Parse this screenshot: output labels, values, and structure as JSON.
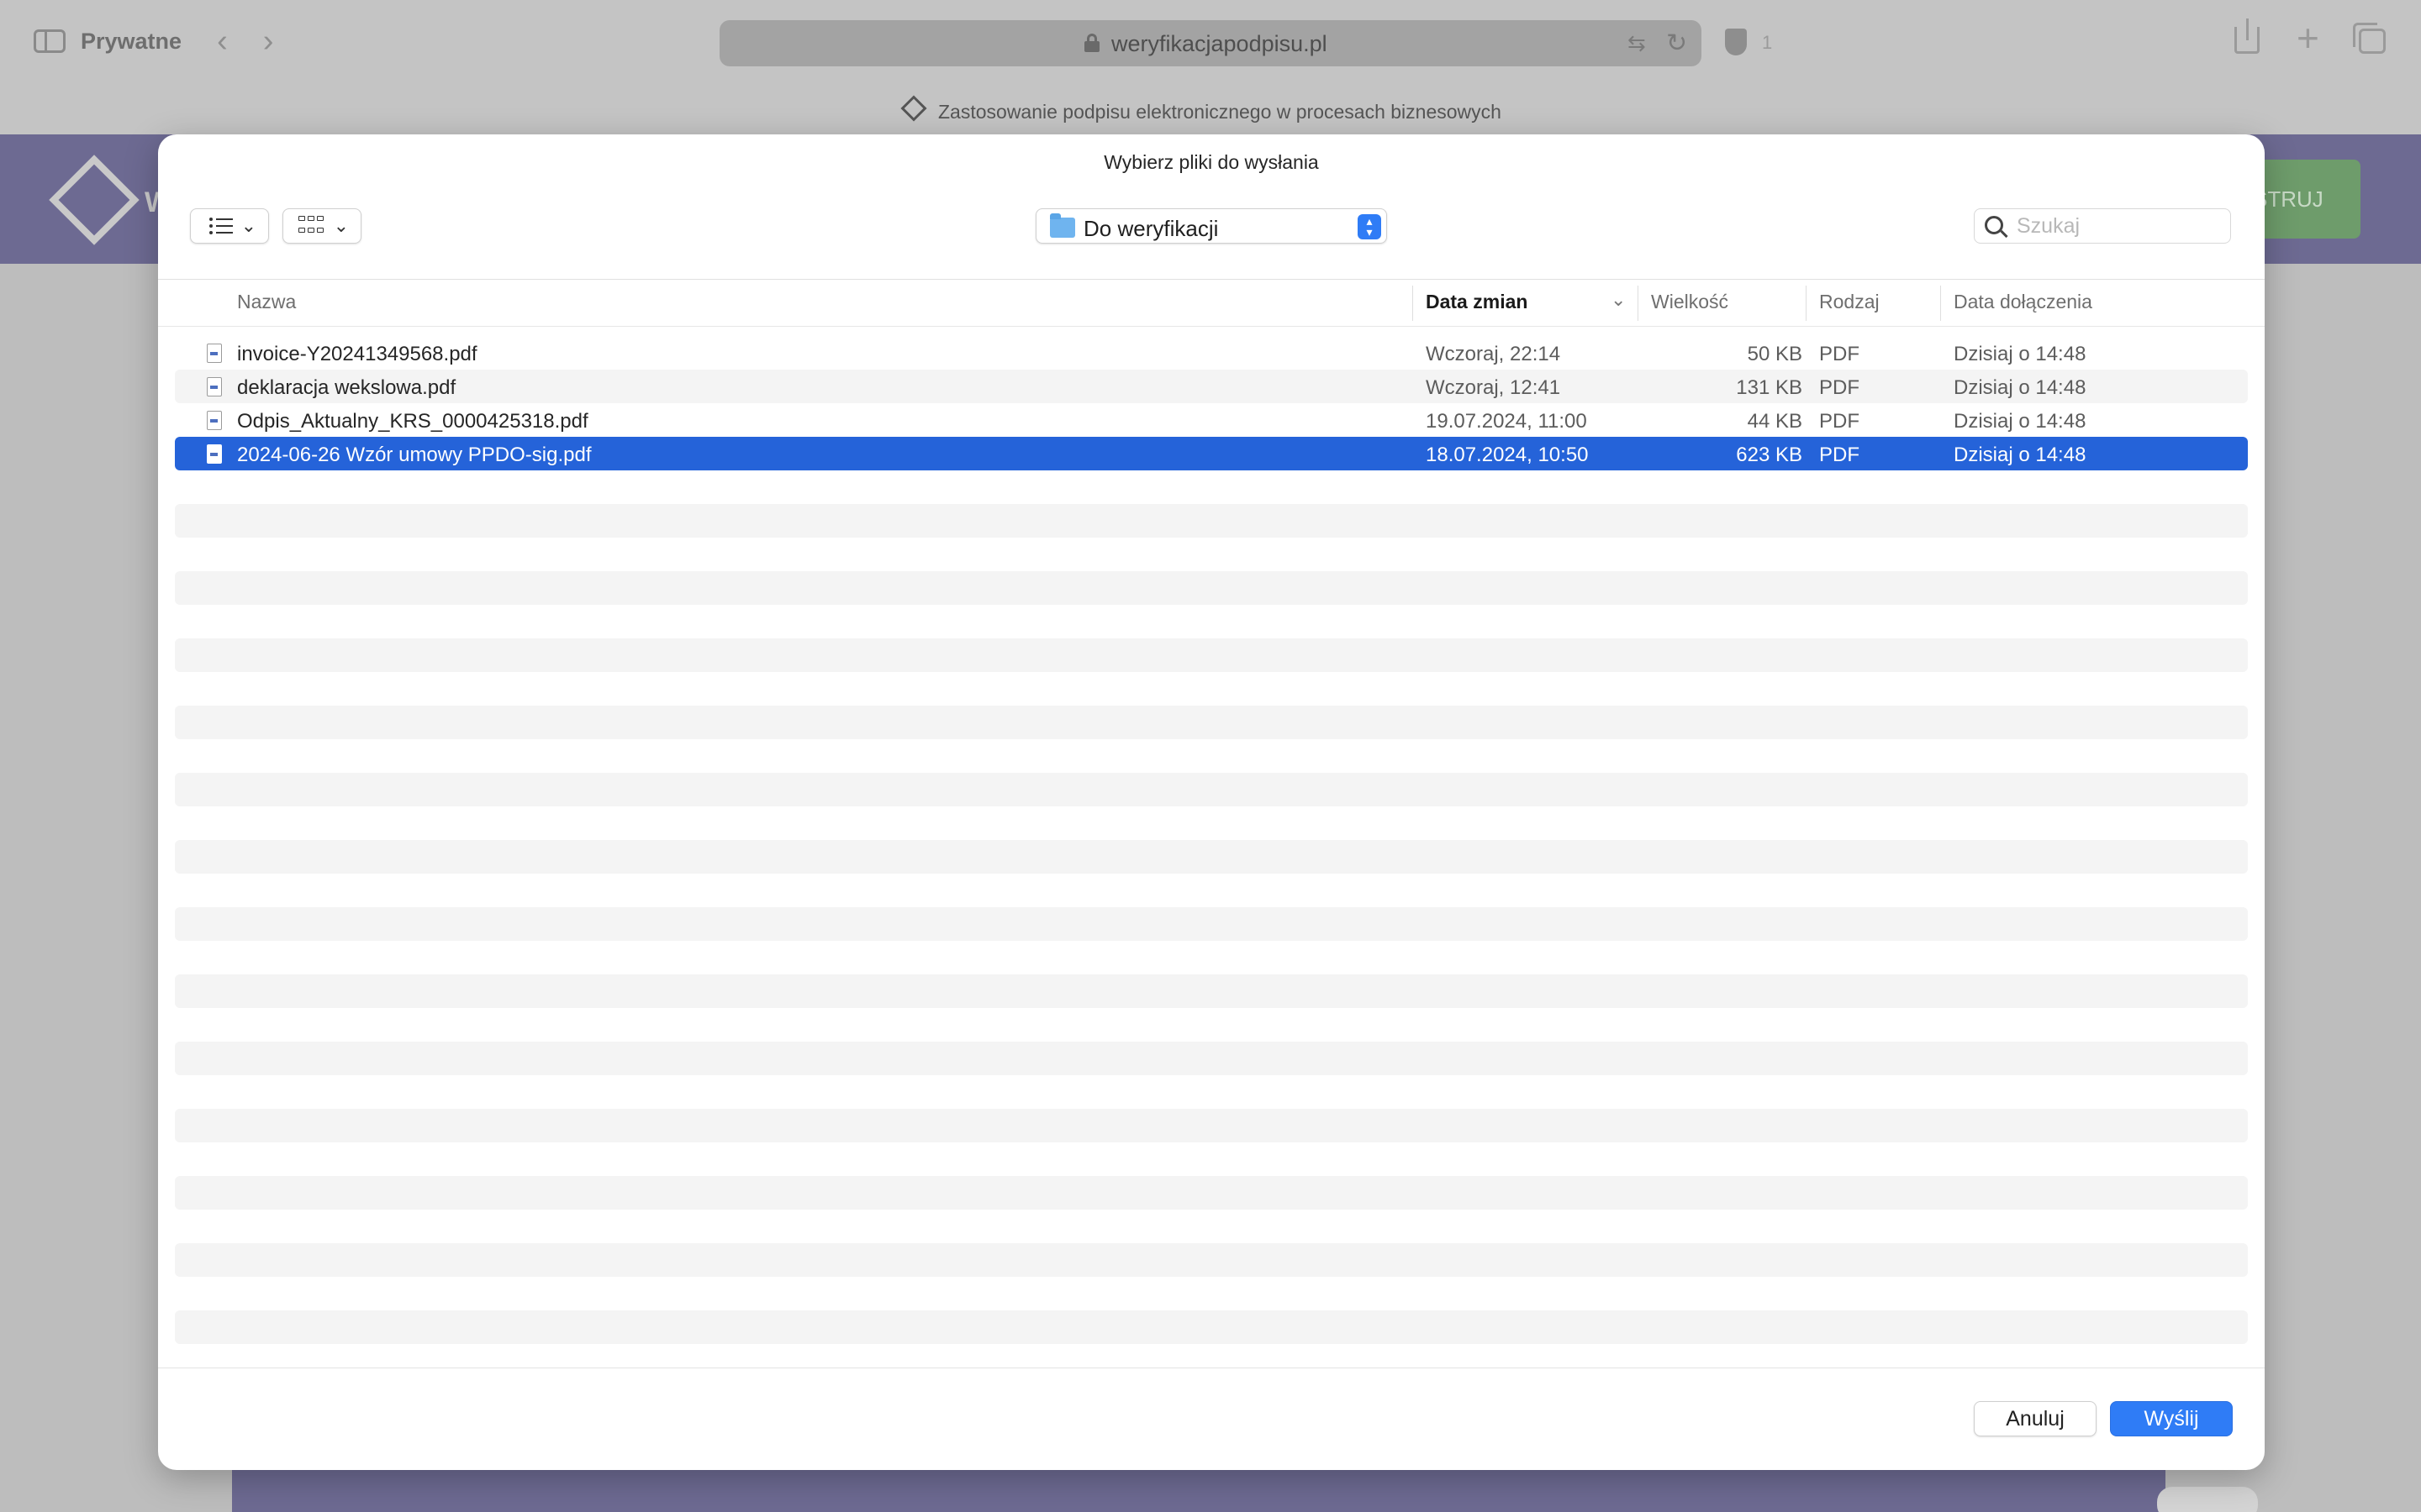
{
  "browser": {
    "private_label": "Prywatne",
    "back_glyph": "‹",
    "forward_glyph": "›",
    "address": "weryfikacjapodpisu.pl",
    "shield_count": "1",
    "tab_title": "Zastosowanie podpisu elektronicznego w procesach biznesowych"
  },
  "page_behind": {
    "logo_letter": "W",
    "header_button": "STRUJ",
    "header_color": "#6d6a92",
    "button_color": "#6e9c6b"
  },
  "dialog": {
    "title": "Wybierz pliki do wysłania",
    "folder": "Do weryfikacji",
    "search_placeholder": "Szukaj",
    "columns": {
      "name": "Nazwa",
      "modified": "Data zmian",
      "size": "Wielkość",
      "kind": "Rodzaj",
      "added": "Data dołączenia"
    },
    "sorted_column": "modified",
    "files": [
      {
        "name": "invoice-Y20241349568.pdf",
        "modified": "Wczoraj, 22:14",
        "size": "50 KB",
        "kind": "PDF",
        "added": "Dzisiaj o 14:48"
      },
      {
        "name": "deklaracja wekslowa.pdf",
        "modified": "Wczoraj, 12:41",
        "size": "131 KB",
        "kind": "PDF",
        "added": "Dzisiaj o 14:48"
      },
      {
        "name": "Odpis_Aktualny_KRS_0000425318.pdf",
        "modified": "19.07.2024, 11:00",
        "size": "44 KB",
        "kind": "PDF",
        "added": "Dzisiaj o 14:48"
      },
      {
        "name": "2024-06-26 Wzór umowy PPDO-sig.pdf",
        "modified": "18.07.2024, 10:50",
        "size": "623 KB",
        "kind": "PDF",
        "added": "Dzisiaj o 14:48"
      }
    ],
    "selected_index": 3,
    "cancel_label": "Anuluj",
    "send_label": "Wyślij",
    "accent_color": "#2f7cf6",
    "selection_color": "#2563d9"
  }
}
